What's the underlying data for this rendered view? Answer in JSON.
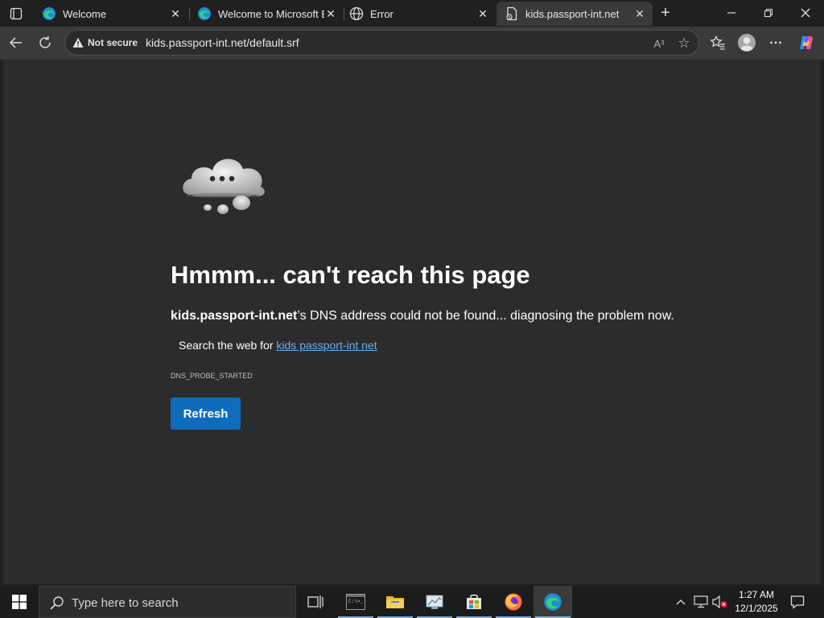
{
  "tabs": [
    {
      "title": "Welcome",
      "favicon": "edge-icon"
    },
    {
      "title": "Welcome to Microsoft E",
      "favicon": "edge-icon"
    },
    {
      "title": "Error",
      "favicon": "globe-icon"
    },
    {
      "title": "kids.passport-int.net",
      "favicon": "page-icon",
      "active": true
    }
  ],
  "address_bar": {
    "security_label": "Not secure",
    "url": "kids.passport-int.net/default.srf",
    "read_aloud": "A³"
  },
  "error_page": {
    "heading": "Hmmm... can't reach this page",
    "host": "kids.passport-int.net",
    "message_rest": "’s DNS address could not be found... diagnosing the problem now.",
    "search_prefix": "Search the web for",
    "search_link": "kids passport-int net",
    "error_code": "DNS_PROBE_STARTED",
    "refresh_label": "Refresh"
  },
  "taskbar": {
    "search_placeholder": "Type here to search",
    "time": "1:27 AM",
    "date": "12/1/2025"
  },
  "colors": {
    "accent": "#0f6cbd",
    "link": "#6aaff0",
    "page_bg": "#2c2c2c"
  }
}
